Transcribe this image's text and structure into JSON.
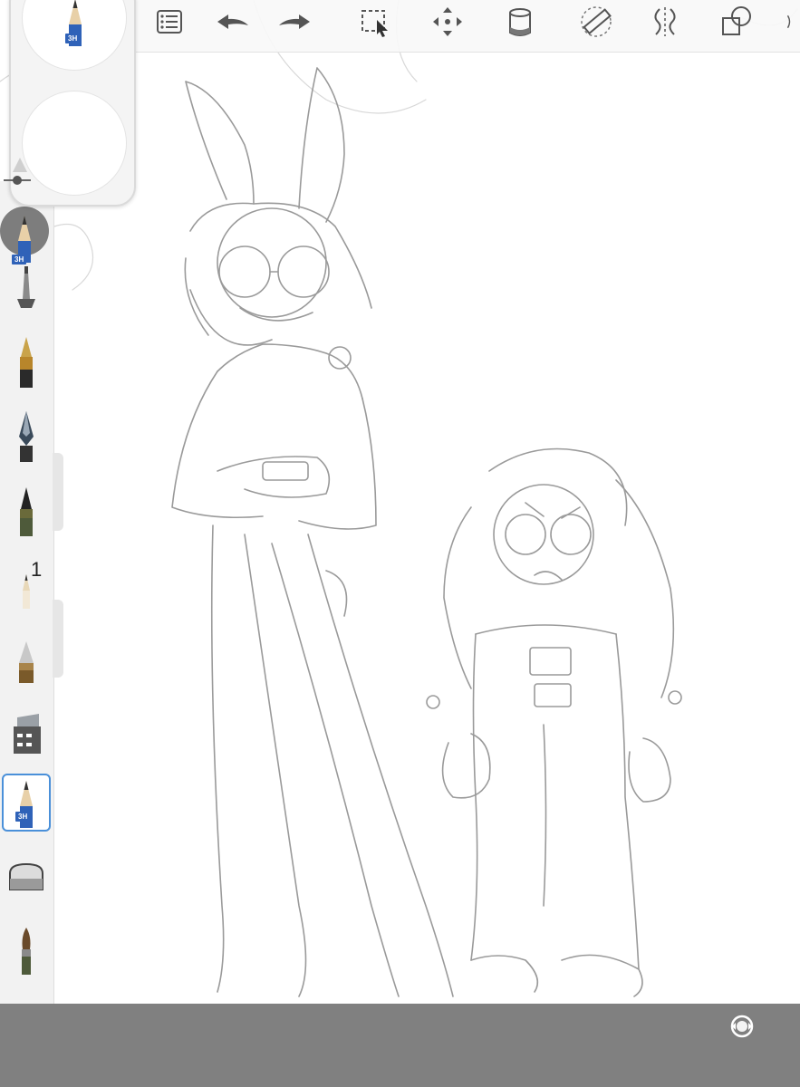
{
  "toolbar": {
    "items": [
      {
        "name": "layers-list-icon"
      },
      {
        "name": "undo-icon"
      },
      {
        "name": "redo-icon"
      },
      {
        "name": "selection-icon"
      },
      {
        "name": "transform-move-icon"
      },
      {
        "name": "fill-bucket-icon"
      },
      {
        "name": "ruler-icon"
      },
      {
        "name": "symmetry-icon"
      },
      {
        "name": "shapes-icon"
      }
    ]
  },
  "puck": {
    "top_brush_label": "3H"
  },
  "current_brush": {
    "label": "3H"
  },
  "brush_tools": [
    {
      "name": "airbrush-icon"
    },
    {
      "name": "ink-pen-icon"
    },
    {
      "name": "technical-pen-icon"
    },
    {
      "name": "marker-icon"
    },
    {
      "name": "fine-pencil-icon"
    },
    {
      "name": "paint-brush-icon"
    },
    {
      "name": "stamp-icon"
    },
    {
      "name": "pencil-3h-icon"
    },
    {
      "name": "eraser-icon"
    },
    {
      "name": "round-brush-icon"
    }
  ],
  "selected_brush": {
    "label": "3H"
  },
  "brush_badge": "1",
  "colors": {
    "accent": "#4a90d9",
    "hardness_badge": "#2f62b8",
    "bottom_bar": "#808080"
  }
}
